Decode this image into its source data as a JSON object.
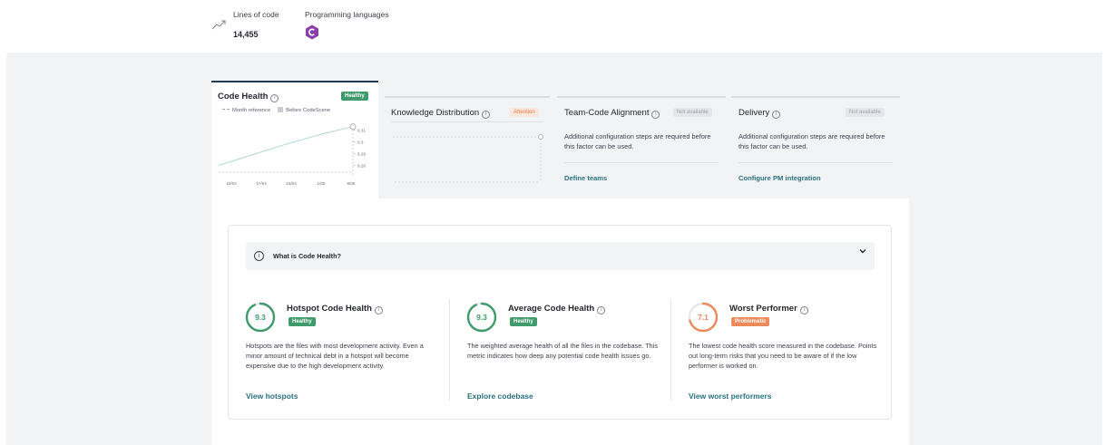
{
  "header": {
    "lines_label": "Lines of code",
    "lines_value": "14,455",
    "languages_label": "Programming languages",
    "language_icon": "csharp-icon"
  },
  "cards": {
    "code_health": {
      "title": "Code Health",
      "badge": "Healthy",
      "legend_month": "Month reference",
      "legend_before": "Before CodeScene",
      "chart_data": {
        "type": "line",
        "x": [
          "10/04",
          "17/04",
          "24/04",
          "1/05",
          "8/05"
        ],
        "y_ticks": [
          "9.31",
          "9.3",
          "9.29",
          "9.28"
        ],
        "series": [
          {
            "values": [
              9.28,
              9.289,
              9.298,
              9.306,
              9.313
            ]
          }
        ],
        "ylim": [
          9.275,
          9.315
        ]
      }
    },
    "knowledge": {
      "title": "Knowledge Distribution",
      "badge": "Attention"
    },
    "team": {
      "title": "Team-Code Alignment",
      "badge": "Not available",
      "desc": "Additional configuration steps are required before this factor can be used.",
      "link": "Define teams"
    },
    "delivery": {
      "title": "Delivery",
      "badge": "Not available",
      "desc": "Additional configuration steps are required before this factor can be used.",
      "link": "Configure PM integration"
    }
  },
  "accordion": {
    "title": "What is Code Health?"
  },
  "metrics": [
    {
      "score": "9.3",
      "title": "Hotspot Code Health",
      "badge": "Healthy",
      "desc": "Hotspots are the files with most development activity. Even a minor amount of technical debt in a hotspot will become expensive due to the high development activity.",
      "link": "View hotspots",
      "fraction": 0.93
    },
    {
      "score": "9.3",
      "title": "Average Code Health",
      "badge": "Healthy",
      "desc": "The weighted average health of all the files in the codebase. This metric indicates how deep any potential code health issues go.",
      "link": "Explore codebase",
      "fraction": 0.93
    },
    {
      "score": "7.1",
      "title": "Worst Performer",
      "badge": "Problematic",
      "desc": "The lowest code health score measured in the codebase. Points out long-term risks that you need to be aware of if the low performer is worked on.",
      "link": "View worst performers",
      "fraction": 0.71
    }
  ],
  "colors": {
    "healthy": "#3f9b6b",
    "problematic": "#ec8a5a",
    "link": "#2a7181",
    "active_border": "#1f3b57"
  }
}
